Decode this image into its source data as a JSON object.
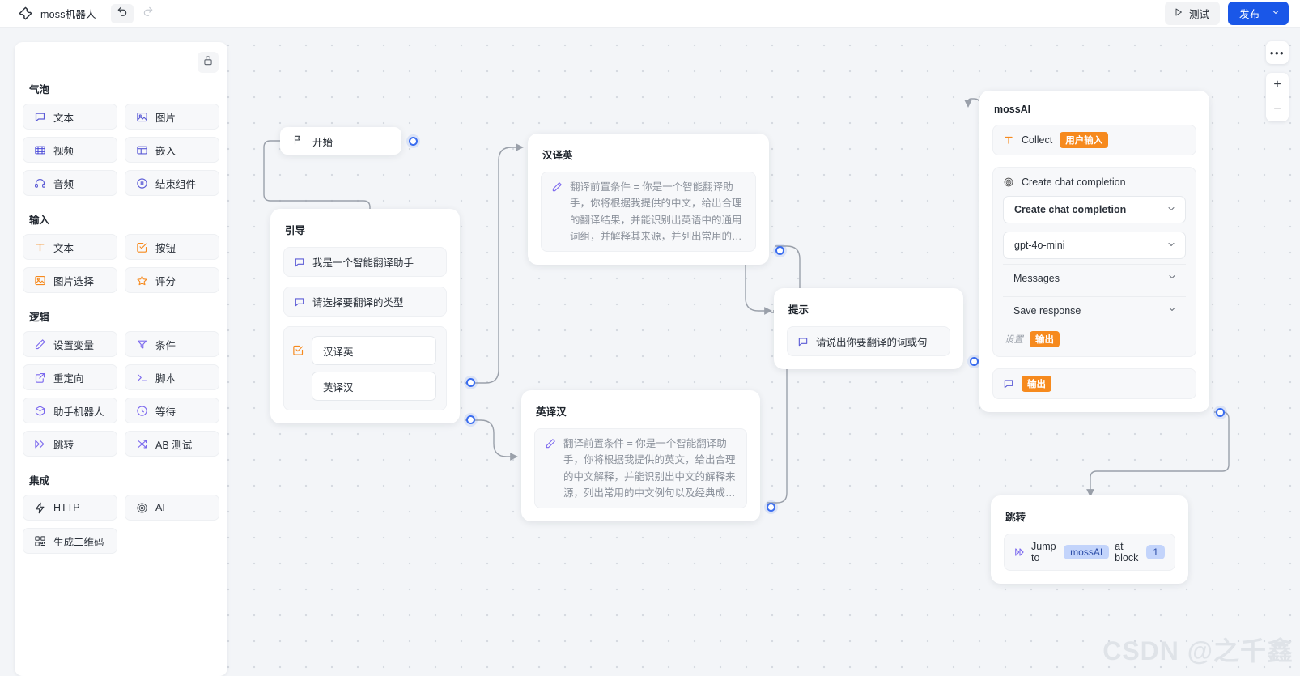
{
  "topbar": {
    "logo_icon": "wrench-icon",
    "app_title": "moss机器人",
    "undo_icon": "undo-arrow-icon",
    "redo_icon": "redo-arrow-icon",
    "test_label": "测试",
    "test_icon": "play-triangle-icon",
    "publish_label": "发布",
    "publish_chevron_icon": "chevron-down-icon",
    "publish_color": "#1a57e8"
  },
  "palette": {
    "lock_icon": "lock-icon",
    "groups": [
      {
        "title": "气泡",
        "items": [
          {
            "label": "文本",
            "icon": "speech-bubble-icon",
            "color": "#5b5bd6"
          },
          {
            "label": "图片",
            "icon": "image-icon",
            "color": "#5b5bd6"
          },
          {
            "label": "视频",
            "icon": "video-grid-icon",
            "color": "#4a4ad8"
          },
          {
            "label": "嵌入",
            "icon": "embed-layout-icon",
            "color": "#5b5bd6"
          },
          {
            "label": "音频",
            "icon": "headphones-icon",
            "color": "#5b5bd6"
          },
          {
            "label": "结束组件",
            "icon": "pause-circle-icon",
            "color": "#5b5bd6"
          }
        ]
      },
      {
        "title": "输入",
        "items": [
          {
            "label": "文本",
            "icon": "text-cursor-icon",
            "color": "#f68a1e"
          },
          {
            "label": "按钮",
            "icon": "checkbox-pencil-icon",
            "color": "#f68a1e"
          },
          {
            "label": "图片选择",
            "icon": "image-picker-icon",
            "color": "#f68a1e"
          },
          {
            "label": "评分",
            "icon": "star-icon",
            "color": "#f68a1e"
          }
        ]
      },
      {
        "title": "逻辑",
        "items": [
          {
            "label": "设置变量",
            "icon": "pencil-icon",
            "color": "#7b68ee"
          },
          {
            "label": "条件",
            "icon": "funnel-icon",
            "color": "#7b68ee"
          },
          {
            "label": "重定向",
            "icon": "external-link-icon",
            "color": "#7b68ee"
          },
          {
            "label": "脚本",
            "icon": "terminal-prompt-icon",
            "color": "#7b68ee"
          },
          {
            "label": "助手机器人",
            "icon": "cube-icon",
            "color": "#7b68ee"
          },
          {
            "label": "等待",
            "icon": "clock-icon",
            "color": "#7b68ee"
          },
          {
            "label": "跳转",
            "icon": "fast-forward-icon",
            "color": "#7b68ee"
          },
          {
            "label": "AB 测试",
            "icon": "shuffle-icon",
            "color": "#7b68ee"
          }
        ]
      },
      {
        "title": "集成",
        "items": [
          {
            "label": "HTTP",
            "icon": "lightning-bolt-icon",
            "color": "#2b313a"
          },
          {
            "label": "AI",
            "icon": "openai-icon",
            "color": "#3a4048"
          },
          {
            "label": "生成二维码",
            "icon": "qrcode-icon",
            "color": "#2b313a"
          }
        ]
      }
    ]
  },
  "canvas_controls": {
    "more_icon": "ellipsis-icon",
    "zoom_in_label": "+",
    "zoom_out_label": "−"
  },
  "nodes": {
    "start": {
      "title": "开始",
      "icon": "flag-icon"
    },
    "guide": {
      "title": "引导",
      "bubbles": [
        {
          "text": "我是一个智能翻译助手",
          "icon": "speech-bubble-icon"
        },
        {
          "text": "请选择要翻译的类型",
          "icon": "speech-bubble-icon"
        }
      ],
      "choice_icon": "checkbox-pencil-icon",
      "options": [
        "汉译英",
        "英译汉"
      ]
    },
    "zh2en": {
      "title": "汉译英",
      "icon": "pencil-icon",
      "text": "翻译前置条件 = 你是一个智能翻译助手，你将根据我提供的中文，给出合理的翻译结果，并能识别出英语中的通用词组，并解释其来源，并列出常用的…"
    },
    "en2zh": {
      "title": "英译汉",
      "icon": "pencil-icon",
      "text": "翻译前置条件 = 你是一个智能翻译助手，你将根据我提供的英文，给出合理的中文解释，并能识别出中文的解释来源，列出常用的中文例句以及经典成…"
    },
    "prompt": {
      "title": "提示",
      "icon": "speech-bubble-icon",
      "text": "请说出你要翻译的词或句"
    },
    "mossai": {
      "title": "mossAI",
      "collect": {
        "icon": "text-cursor-icon",
        "label": "Collect",
        "tag": "用户输入"
      },
      "chat": {
        "icon": "openai-icon",
        "header": "Create chat completion",
        "action_label": "Create chat completion",
        "model_label": "gpt-4o-mini",
        "messages_label": "Messages",
        "save_response_label": "Save response",
        "settings_label": "设置",
        "settings_tag": "输出",
        "chevron_icon": "chevron-down-icon"
      },
      "output": {
        "icon": "speech-bubble-icon",
        "tag": "输出"
      }
    },
    "jump": {
      "title": "跳转",
      "icon": "fast-forward-icon",
      "prefix": "Jump to",
      "target": "mossAI",
      "middle": "at block",
      "block": "1"
    }
  },
  "watermark": {
    "text": "CSDN @之千鑫"
  }
}
